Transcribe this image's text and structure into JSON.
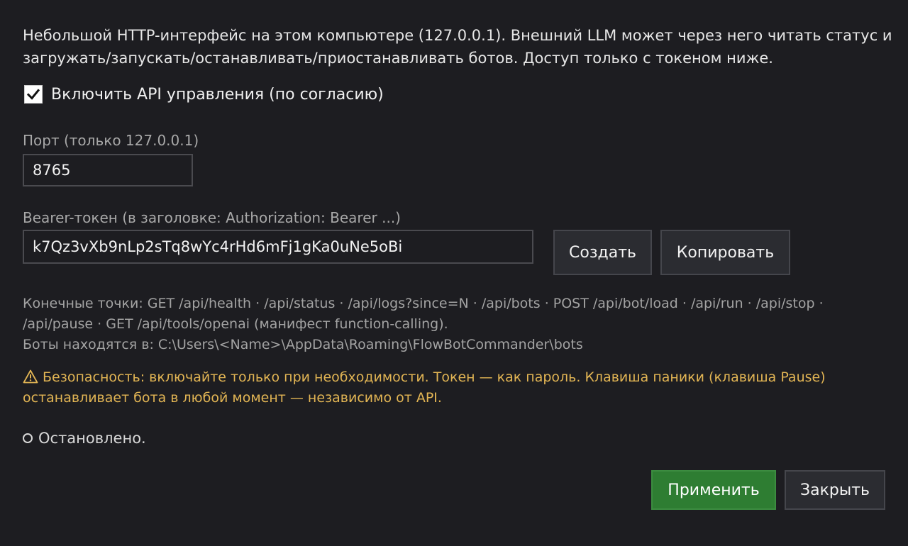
{
  "intro": "Небольшой HTTP-интерфейс на этом компьютере (127.0.0.1). Внешний LLM может через него читать статус и загружать/запускать/останавливать/приостанавливать ботов. Доступ только с токеном ниже.",
  "enable_api": {
    "label": "Включить API управления (по согласию)",
    "checked": true
  },
  "port": {
    "label": "Порт (только 127.0.0.1)",
    "value": "8765"
  },
  "token": {
    "label": "Bearer-токен (в заголовке: Authorization: Bearer ...)",
    "value": "k7Qz3vXb9nLp2sTq8wYc4rHd6mFj1gKa0uNe5oBi",
    "generate_label": "Создать",
    "copy_label": "Копировать"
  },
  "endpoints": {
    "line1": "Конечные точки: GET /api/health · /api/status · /api/logs?since=N · /api/bots · POST /api/bot/load · /api/run · /api/stop · /api/pause · GET /api/tools/openai (манифест function-calling).",
    "line2": "Боты находятся в: C:\\Users\\<Name>\\AppData\\Roaming\\FlowBotCommander\\bots"
  },
  "warning": {
    "icon": "warning-icon",
    "text": "Безопасность: включайте только при необходимости. Токен — как пароль. Клавиша паники (клавиша Pause) останавливает бота в любой момент — независимо от API."
  },
  "status": {
    "icon": "status-circle-icon",
    "text": "Остановлено."
  },
  "footer": {
    "apply_label": "Применить",
    "close_label": "Закрыть"
  },
  "colors": {
    "background": "#1d1d21",
    "warning": "#e2b554",
    "primary_button": "#2e7d32"
  }
}
